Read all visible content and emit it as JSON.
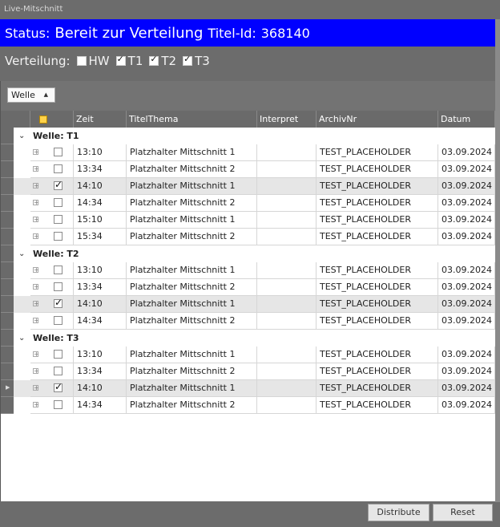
{
  "window": {
    "title": "Live-Mitschnitt"
  },
  "status": {
    "label": "Status:",
    "value": "Bereit zur Verteilung",
    "titel_label": "Titel-Id:",
    "titel_id": "368140",
    "background": "#0000ff"
  },
  "verteilung": {
    "label": "Verteilung:",
    "options": [
      {
        "label": "HW",
        "checked": false
      },
      {
        "label": "T1",
        "checked": true
      },
      {
        "label": "T2",
        "checked": true
      },
      {
        "label": "T3",
        "checked": true
      }
    ]
  },
  "grouping": {
    "button_label": "Welle",
    "sort_icon": "triangle-up-icon"
  },
  "columns": [
    "Zeit",
    "TitelThema",
    "Interpret",
    "ArchivNr",
    "Datum"
  ],
  "groups": [
    {
      "title": "Welle: T1",
      "rows": [
        {
          "zeit": "13:10",
          "titel": "Platzhalter Mittschnitt 1",
          "interpret": "",
          "archiv": "TEST_PLACEHOLDER",
          "datum": "03.09.2024",
          "checked": false,
          "selected": false
        },
        {
          "zeit": "13:34",
          "titel": "Platzhalter Mittschnitt 2",
          "interpret": "",
          "archiv": "TEST_PLACEHOLDER",
          "datum": "03.09.2024",
          "checked": false,
          "selected": false
        },
        {
          "zeit": "14:10",
          "titel": "Platzhalter Mittschnitt 1",
          "interpret": "",
          "archiv": "TEST_PLACEHOLDER",
          "datum": "03.09.2024",
          "checked": true,
          "selected": true
        },
        {
          "zeit": "14:34",
          "titel": "Platzhalter Mittschnitt 2",
          "interpret": "",
          "archiv": "TEST_PLACEHOLDER",
          "datum": "03.09.2024",
          "checked": false,
          "selected": false
        },
        {
          "zeit": "15:10",
          "titel": "Platzhalter Mittschnitt 1",
          "interpret": "",
          "archiv": "TEST_PLACEHOLDER",
          "datum": "03.09.2024",
          "checked": false,
          "selected": false
        },
        {
          "zeit": "15:34",
          "titel": "Platzhalter Mittschnitt 2",
          "interpret": "",
          "archiv": "TEST_PLACEHOLDER",
          "datum": "03.09.2024",
          "checked": false,
          "selected": false
        }
      ]
    },
    {
      "title": "Welle: T2",
      "rows": [
        {
          "zeit": "13:10",
          "titel": "Platzhalter Mittschnitt 1",
          "interpret": "",
          "archiv": "TEST_PLACEHOLDER",
          "datum": "03.09.2024",
          "checked": false,
          "selected": false
        },
        {
          "zeit": "13:34",
          "titel": "Platzhalter Mittschnitt 2",
          "interpret": "",
          "archiv": "TEST_PLACEHOLDER",
          "datum": "03.09.2024",
          "checked": false,
          "selected": false
        },
        {
          "zeit": "14:10",
          "titel": "Platzhalter Mittschnitt 1",
          "interpret": "",
          "archiv": "TEST_PLACEHOLDER",
          "datum": "03.09.2024",
          "checked": true,
          "selected": true
        },
        {
          "zeit": "14:34",
          "titel": "Platzhalter Mittschnitt 2",
          "interpret": "",
          "archiv": "TEST_PLACEHOLDER",
          "datum": "03.09.2024",
          "checked": false,
          "selected": false
        }
      ]
    },
    {
      "title": "Welle: T3",
      "rows": [
        {
          "zeit": "13:10",
          "titel": "Platzhalter Mittschnitt 1",
          "interpret": "",
          "archiv": "TEST_PLACEHOLDER",
          "datum": "03.09.2024",
          "checked": false,
          "selected": false
        },
        {
          "zeit": "13:34",
          "titel": "Platzhalter Mittschnitt 2",
          "interpret": "",
          "archiv": "TEST_PLACEHOLDER",
          "datum": "03.09.2024",
          "checked": false,
          "selected": false
        },
        {
          "zeit": "14:10",
          "titel": "Platzhalter Mittschnitt 1",
          "interpret": "",
          "archiv": "TEST_PLACEHOLDER",
          "datum": "03.09.2024",
          "checked": true,
          "selected": true,
          "current": true
        },
        {
          "zeit": "14:34",
          "titel": "Platzhalter Mittschnitt 2",
          "interpret": "",
          "archiv": "TEST_PLACEHOLDER",
          "datum": "03.09.2024",
          "checked": false,
          "selected": false
        }
      ]
    }
  ],
  "buttons": {
    "distribute": "Distribute",
    "reset": "Reset"
  }
}
